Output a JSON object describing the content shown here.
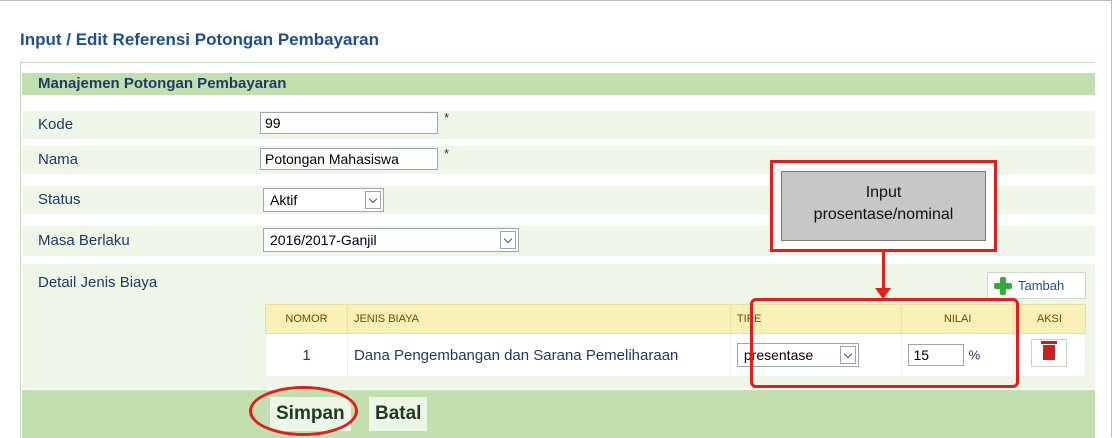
{
  "page": {
    "title": "Input / Edit Referensi Potongan Pembayaran"
  },
  "section": {
    "title": "Manajemen Potongan Pembayaran"
  },
  "form": {
    "kode": {
      "label": "Kode",
      "value": "99",
      "required_mark": "*"
    },
    "nama": {
      "label": "Nama",
      "value": "Potongan Mahasiswa",
      "required_mark": "*"
    },
    "status": {
      "label": "Status",
      "selected": "Aktif"
    },
    "masa_berlaku": {
      "label": "Masa Berlaku",
      "selected": "2016/2017-Ganjil"
    },
    "detail": {
      "label": "Detail Jenis Biaya",
      "add_button": "Tambah"
    }
  },
  "table": {
    "headers": [
      "NOMOR",
      "JENIS BIAYA",
      "TIPE",
      "NILAI",
      "AKSI"
    ],
    "rows": [
      {
        "nomor": "1",
        "jenis_biaya": "Dana Pengembangan dan Sarana Pemeliharaan",
        "tipe": "presentase",
        "nilai": "15",
        "unit": "%"
      }
    ]
  },
  "actions": {
    "save": "Simpan",
    "cancel": "Batal"
  },
  "annotation": {
    "line1": "Input",
    "line2": "prosentase/nominal"
  },
  "colors": {
    "accent_red": "#e31c1c",
    "header_green": "#c2dfb0",
    "row_green": "#eef6e7",
    "title_blue": "#1f4e8c"
  }
}
